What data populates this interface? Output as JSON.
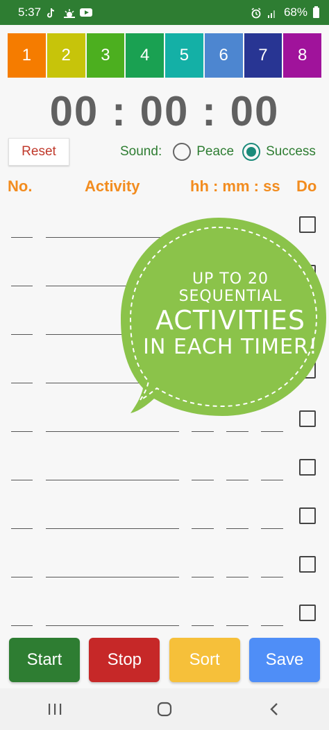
{
  "status_bar": {
    "time": "5:37",
    "battery": "68%",
    "icons": [
      "tiktok-icon",
      "weather-icon",
      "youtube-icon",
      "alarm-icon",
      "signal-icon",
      "battery-icon"
    ]
  },
  "tabs": [
    {
      "label": "1",
      "color": "#f57c00"
    },
    {
      "label": "2",
      "color": "#c7c40a"
    },
    {
      "label": "3",
      "color": "#4caf1f"
    },
    {
      "label": "4",
      "color": "#1aa152"
    },
    {
      "label": "5",
      "color": "#14b0a6"
    },
    {
      "label": "6",
      "color": "#4d86d0"
    },
    {
      "label": "7",
      "color": "#283593"
    },
    {
      "label": "8",
      "color": "#a0139b"
    }
  ],
  "clock": "00 : 00 : 00",
  "reset_label": "Reset",
  "sound": {
    "label": "Sound:",
    "options": [
      "Peace",
      "Success"
    ],
    "selected": "Success"
  },
  "columns": {
    "no": "No.",
    "activity": "Activity",
    "time": "hh : mm : ss",
    "done": "Do"
  },
  "promo": {
    "line1": "UP TO 20 SEQUENTIAL",
    "line2": "ACTIVITIES",
    "line3": "IN EACH TIMER!",
    "color": "#8bc34a"
  },
  "actions": [
    {
      "label": "Start",
      "color": "#2e7d32"
    },
    {
      "label": "Stop",
      "color": "#c62828"
    },
    {
      "label": "Sort",
      "color": "#f6c03a"
    },
    {
      "label": "Save",
      "color": "#4f8ef7"
    }
  ],
  "nav": [
    "recent-apps-icon",
    "home-icon",
    "back-icon"
  ]
}
